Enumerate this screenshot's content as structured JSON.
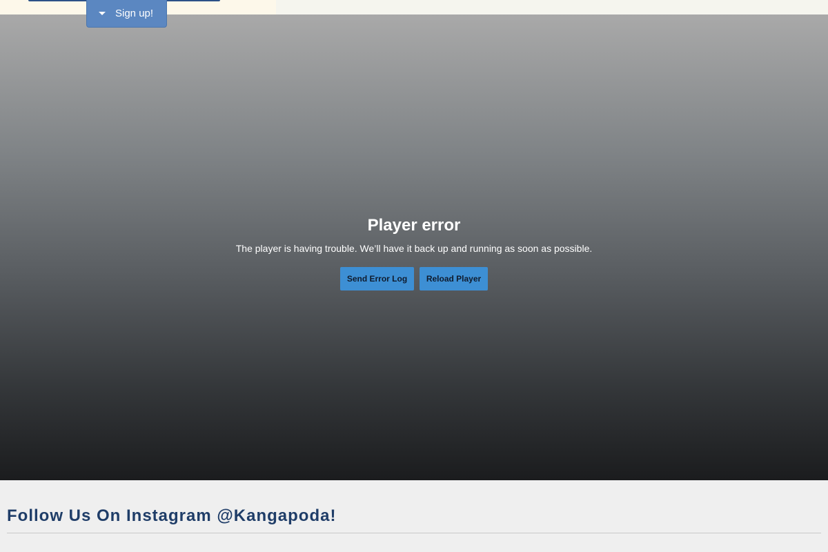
{
  "header": {
    "signup_label": "Sign up!"
  },
  "player": {
    "error_title": "Player error",
    "error_message": "The player is having trouble. We’ll have it back up and running as soon as possible.",
    "send_log_label": "Send Error Log",
    "reload_label": "Reload Player"
  },
  "instagram": {
    "heading": "Follow Us On Instagram @Kangapoda!"
  },
  "colors": {
    "signup_bg": "#5b87c1",
    "player_button_bg": "#3d8fd4",
    "heading_text": "#1f3d68"
  },
  "icons": {
    "signup_caret": "caret-down-icon"
  }
}
